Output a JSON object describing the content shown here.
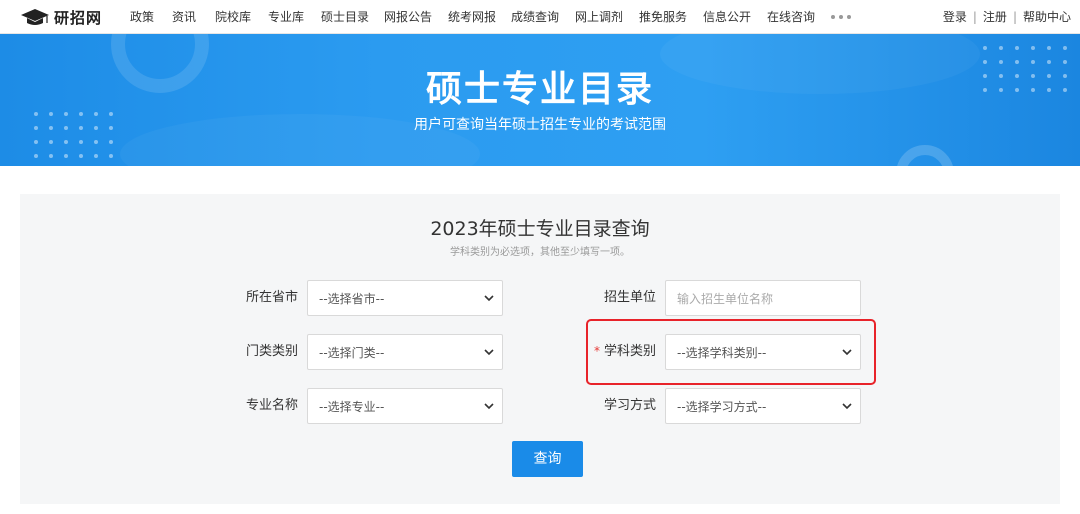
{
  "site": {
    "logo_text": "研招网"
  },
  "nav": {
    "items": [
      {
        "label": "政策"
      },
      {
        "label": "资讯"
      },
      {
        "label": "院校库"
      },
      {
        "label": "专业库"
      },
      {
        "label": "硕士目录"
      },
      {
        "label": "网报公告"
      },
      {
        "label": "统考网报"
      },
      {
        "label": "成绩查询"
      },
      {
        "label": "网上调剂"
      },
      {
        "label": "推免服务"
      },
      {
        "label": "信息公开"
      },
      {
        "label": "在线咨询"
      }
    ],
    "more_icon": "more-dots-icon"
  },
  "user_links": {
    "login": "登录",
    "register": "注册",
    "help": "帮助中心",
    "separator": "|"
  },
  "banner": {
    "title": "硕士专业目录",
    "subtitle": "用户可查询当年硕士招生专业的考试范围"
  },
  "panel": {
    "title": "2023年硕士专业目录查询",
    "hint": "学科类别为必选项，其他至少填写一项。"
  },
  "form": {
    "province": {
      "label": "所在省市",
      "selected": "--选择省市--"
    },
    "unit": {
      "label": "招生单位",
      "placeholder": "输入招生单位名称"
    },
    "category": {
      "label": "门类类别",
      "selected": "--选择门类--"
    },
    "discipline": {
      "label": "学科类别",
      "selected": "--选择学科类别--",
      "required_mark": "*"
    },
    "major": {
      "label": "专业名称",
      "selected": "--选择专业--"
    },
    "study_mode": {
      "label": "学习方式",
      "selected": "--选择学习方式--"
    },
    "submit_label": "查询"
  },
  "colors": {
    "primary": "#1a8be8",
    "banner_blue": "#2b9bf0",
    "panel_bg": "#f5f6f7",
    "highlight_red": "#e8232a",
    "required_red": "#e53935"
  }
}
